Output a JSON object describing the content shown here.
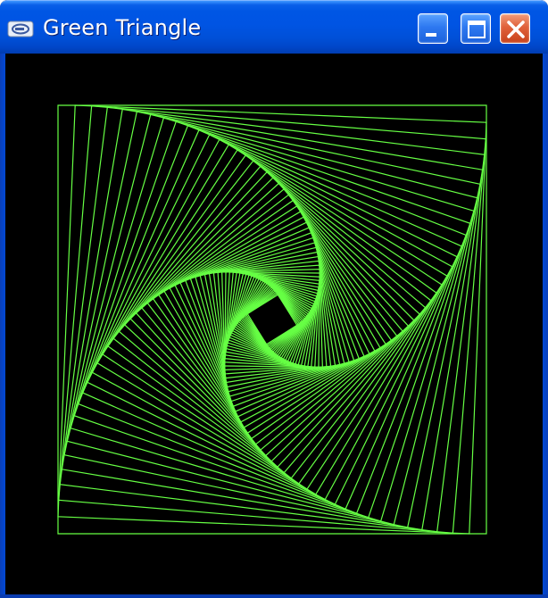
{
  "window": {
    "title": "Green Triangle",
    "icons": {
      "app": "app-icon",
      "minimize": "minimize-icon",
      "maximize": "maximize-icon",
      "close": "close-icon"
    }
  },
  "canvas": {
    "background": "#000000",
    "line_color": "#66ff44",
    "pattern": "rotating-nested-squares",
    "square_count": 90
  }
}
